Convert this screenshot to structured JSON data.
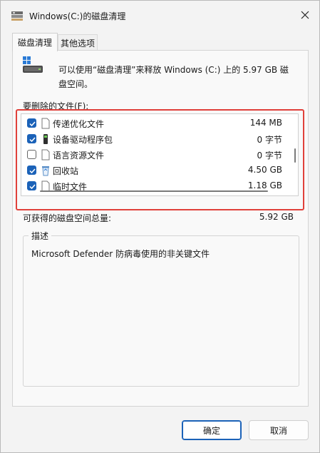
{
  "window": {
    "title": "Windows(C:)的磁盘清理"
  },
  "tabs": [
    {
      "label": "磁盘清理",
      "active": true
    },
    {
      "label": "其他选项",
      "active": false
    }
  ],
  "intro": {
    "text": "可以使用“磁盘清理”来释放 Windows (C:) 上的 5.97 GB 磁盘空间。"
  },
  "files": {
    "label": "要删除的文件(F):",
    "items": [
      {
        "name": "传递优化文件",
        "size": "144 MB",
        "checked": true,
        "icon": "file-icon"
      },
      {
        "name": "设备驱动程序包",
        "size": "0 字节",
        "checked": true,
        "icon": "driver-package-icon"
      },
      {
        "name": "语言资源文件",
        "size": "0 字节",
        "checked": false,
        "icon": "file-icon"
      },
      {
        "name": "回收站",
        "size": "4.50 GB",
        "checked": true,
        "icon": "recycle-bin-icon"
      },
      {
        "name": "临时文件",
        "size": "1.18 GB",
        "checked": true,
        "icon": "file-icon"
      }
    ]
  },
  "total": {
    "label": "可获得的磁盘空间总量:",
    "value": "5.92 GB"
  },
  "description": {
    "title": "描述",
    "text": "Microsoft Defender 防病毒使用的非关键文件"
  },
  "buttons": {
    "ok": "确定",
    "cancel": "取消"
  },
  "colors": {
    "accent": "#1b62b8",
    "highlight": "#e0403a"
  }
}
